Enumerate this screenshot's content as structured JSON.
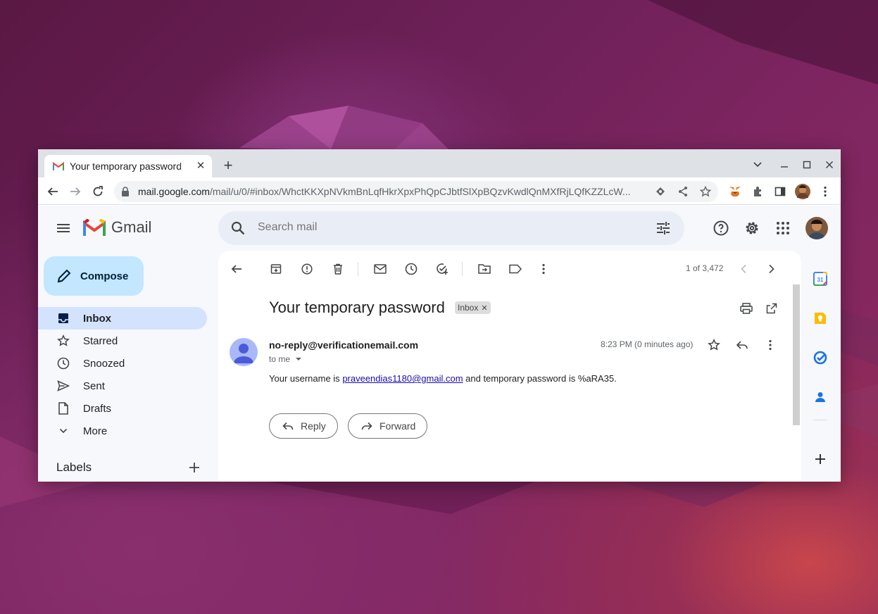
{
  "browser": {
    "tab_title": "Your temporary password",
    "url_host": "mail.google.com",
    "url_path": "/mail/u/0/#inbox/WhctKKXpNVkmBnLqfHkrXpxPhQpCJbtfSlXpBQzvKwdlQnMXfRjLQfKZZLcW..."
  },
  "gmail": {
    "logo_text": "Gmail",
    "search_placeholder": "Search mail",
    "compose_label": "Compose",
    "nav": [
      {
        "label": "Inbox",
        "icon": "inbox-icon",
        "active": true
      },
      {
        "label": "Starred",
        "icon": "star-icon"
      },
      {
        "label": "Snoozed",
        "icon": "clock-icon"
      },
      {
        "label": "Sent",
        "icon": "send-icon"
      },
      {
        "label": "Drafts",
        "icon": "draft-icon"
      },
      {
        "label": "More",
        "icon": "chevron-down-icon"
      }
    ],
    "labels_heading": "Labels"
  },
  "message": {
    "count": "1 of 3,472",
    "subject": "Your temporary password",
    "label_badge": "Inbox",
    "sender": "no-reply@verificationemail.com",
    "recipient": "to me",
    "time": "8:23 PM (0 minutes ago)",
    "body_prefix": "Your username is ",
    "body_link": "praveendias1180@gmail.com",
    "body_suffix": " and temporary password is %aRA35.",
    "reply_label": "Reply",
    "forward_label": "Forward"
  },
  "side_panel": {
    "calendar_day": "31"
  },
  "colors": {
    "compose_bg": "#c2e7ff",
    "active_nav_bg": "#d3e3fd",
    "search_bg": "#e9eef6",
    "pane_bg": "#f6f8fc",
    "link": "#1a0dab"
  }
}
